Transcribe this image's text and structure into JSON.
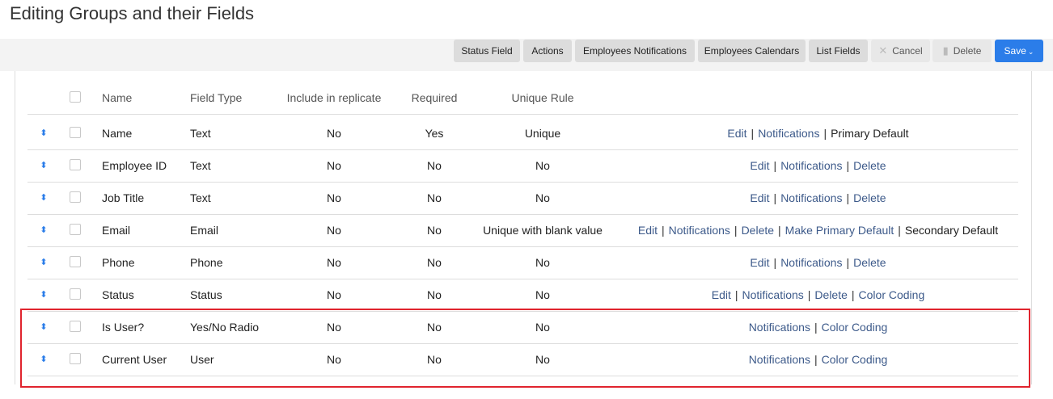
{
  "page": {
    "title": "Editing Groups and their Fields"
  },
  "toolbar": {
    "status_field": "Status Field",
    "actions": "Actions",
    "employees_notifications": "Employees Notifications",
    "employees_calendars": "Employees Calendars",
    "list_fields": "List Fields",
    "cancel": "Cancel",
    "delete": "Delete",
    "save": "Save"
  },
  "table": {
    "headers": {
      "name": "Name",
      "field_type": "Field Type",
      "include_in_replicate": "Include in replicate",
      "required": "Required",
      "unique_rule": "Unique Rule"
    },
    "rows": [
      {
        "name": "Name",
        "type": "Text",
        "replicate": "No",
        "required": "Yes",
        "unique": "Unique",
        "actions": [
          {
            "label": "Edit",
            "link": true
          },
          {
            "label": "Notifications",
            "link": true
          },
          {
            "label": "Primary Default",
            "link": false
          }
        ]
      },
      {
        "name": "Employee ID",
        "type": "Text",
        "replicate": "No",
        "required": "No",
        "unique": "No",
        "actions": [
          {
            "label": "Edit",
            "link": true
          },
          {
            "label": "Notifications",
            "link": true
          },
          {
            "label": "Delete",
            "link": true
          }
        ]
      },
      {
        "name": "Job Title",
        "type": "Text",
        "replicate": "No",
        "required": "No",
        "unique": "No",
        "actions": [
          {
            "label": "Edit",
            "link": true
          },
          {
            "label": "Notifications",
            "link": true
          },
          {
            "label": "Delete",
            "link": true
          }
        ]
      },
      {
        "name": "Email",
        "type": "Email",
        "replicate": "No",
        "required": "No",
        "unique": "Unique with blank value",
        "actions": [
          {
            "label": "Edit",
            "link": true
          },
          {
            "label": "Notifications",
            "link": true
          },
          {
            "label": "Delete",
            "link": true
          },
          {
            "label": "Make Primary Default",
            "link": true
          },
          {
            "label": "Secondary Default",
            "link": false
          }
        ]
      },
      {
        "name": "Phone",
        "type": "Phone",
        "replicate": "No",
        "required": "No",
        "unique": "No",
        "actions": [
          {
            "label": "Edit",
            "link": true
          },
          {
            "label": "Notifications",
            "link": true
          },
          {
            "label": "Delete",
            "link": true
          }
        ]
      },
      {
        "name": "Status",
        "type": "Status",
        "replicate": "No",
        "required": "No",
        "unique": "No",
        "actions": [
          {
            "label": "Edit",
            "link": true
          },
          {
            "label": "Notifications",
            "link": true
          },
          {
            "label": "Delete",
            "link": true
          },
          {
            "label": "Color Coding",
            "link": true
          }
        ]
      },
      {
        "name": "Is User?",
        "type": "Yes/No Radio",
        "replicate": "No",
        "required": "No",
        "unique": "No",
        "actions": [
          {
            "label": "Notifications",
            "link": true
          },
          {
            "label": "Color Coding",
            "link": true
          }
        ]
      },
      {
        "name": "Current User",
        "type": "User",
        "replicate": "No",
        "required": "No",
        "unique": "No",
        "actions": [
          {
            "label": "Notifications",
            "link": true
          },
          {
            "label": "Color Coding",
            "link": true
          }
        ]
      }
    ]
  },
  "colors": {
    "accent": "#2b7de9",
    "link": "#3d5a8a",
    "highlight": "#e0242e"
  }
}
